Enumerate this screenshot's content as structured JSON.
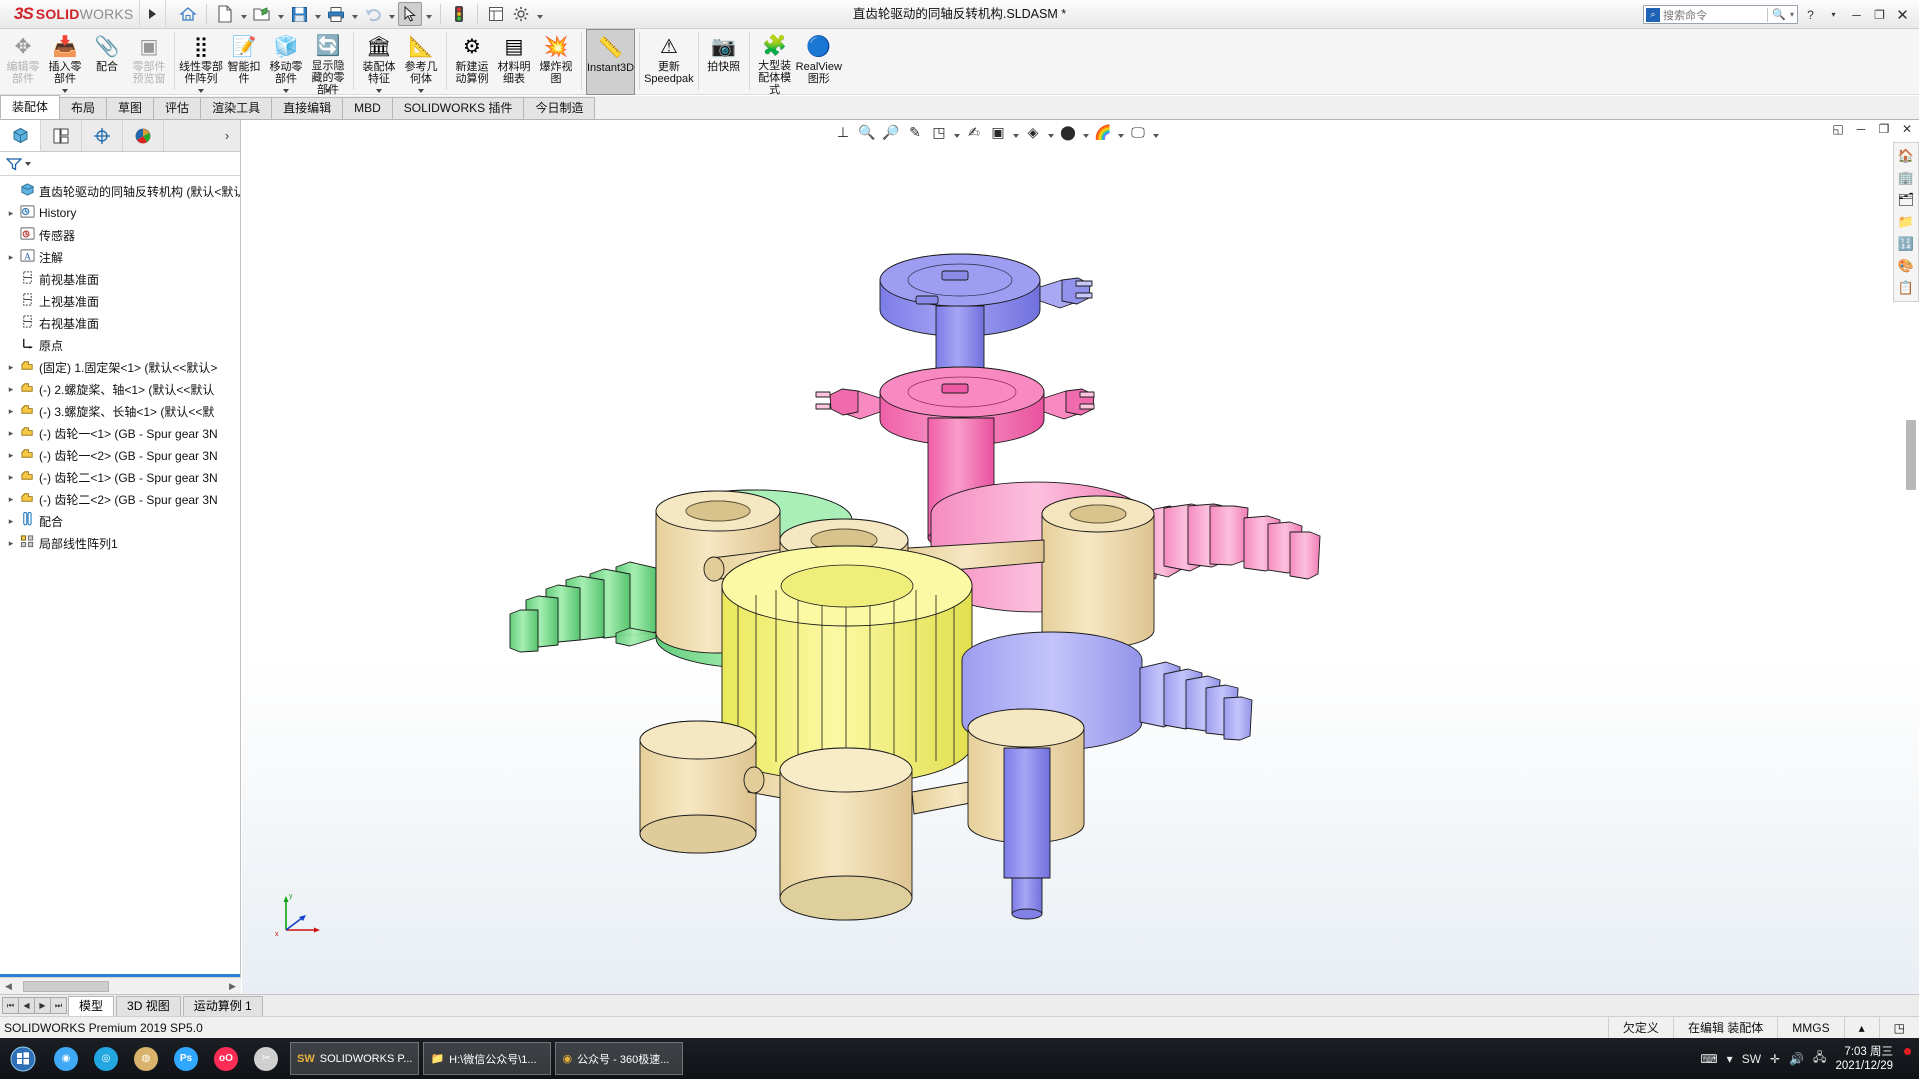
{
  "titlebar": {
    "logo_ds": "3S",
    "logo_solid": "SOLID",
    "logo_works": "WORKS",
    "document_title": "直齿轮驱动的同轴反转机构.SLDASM *",
    "quick_access": [
      {
        "name": "home-icon",
        "glyph": "⌂"
      },
      {
        "name": "new-document-icon",
        "glyph": "🗋"
      },
      {
        "name": "open-document-icon",
        "glyph": "📂"
      },
      {
        "name": "save-icon",
        "glyph": "💾"
      },
      {
        "name": "print-icon",
        "glyph": "🖶"
      },
      {
        "name": "undo-icon",
        "glyph": "↩"
      },
      {
        "name": "select-icon",
        "glyph": "➤"
      },
      {
        "name": "rebuild-icon",
        "glyph": "🚦"
      },
      {
        "name": "options-page-icon",
        "glyph": "▤"
      },
      {
        "name": "settings-gear-icon",
        "glyph": "⚙"
      }
    ],
    "search_placeholder": "搜索命令",
    "window_buttons": [
      "?",
      "▾",
      "─",
      "❐",
      "✕"
    ]
  },
  "ribbon": {
    "buttons": [
      {
        "label": "编辑零\n部件",
        "icon": "✥",
        "state": "disabled",
        "dropdown": false
      },
      {
        "label": "插入零\n部件",
        "icon": "📥",
        "state": "normal",
        "dropdown": true
      },
      {
        "label": "配合",
        "icon": "📎",
        "state": "normal",
        "dropdown": false
      },
      {
        "label": "零部件\n预览窗",
        "icon": "▣",
        "state": "disabled",
        "dropdown": false
      },
      {
        "label": "线性零部\n件阵列",
        "icon": "⣿",
        "state": "normal",
        "dropdown": true
      },
      {
        "label": "智能扣\n件",
        "icon": "📝",
        "state": "normal",
        "dropdown": false
      },
      {
        "label": "移动零\n部件",
        "icon": "🧊",
        "state": "normal",
        "dropdown": true
      },
      {
        "label": "显示隐\n藏的零\n部件",
        "icon": "🔄",
        "state": "normal",
        "dropdown": true
      },
      {
        "label": "装配体\n特征",
        "icon": "🏛",
        "state": "normal",
        "dropdown": true
      },
      {
        "label": "参考几\n何体",
        "icon": "📐",
        "state": "normal",
        "dropdown": true
      },
      {
        "label": "新建运\n动算例",
        "icon": "⚙",
        "state": "normal",
        "dropdown": false
      },
      {
        "label": "材料明\n细表",
        "icon": "▤",
        "state": "normal",
        "dropdown": false
      },
      {
        "label": "爆炸视\n图",
        "icon": "💥",
        "state": "normal",
        "dropdown": false
      },
      {
        "label": "Instant3D",
        "icon": "📏",
        "state": "active",
        "dropdown": false
      },
      {
        "label": "更新\nSpeedpak",
        "icon": "⚠",
        "state": "normal",
        "dropdown": false
      },
      {
        "label": "拍快照",
        "icon": "📷",
        "state": "normal",
        "dropdown": false
      },
      {
        "label": "大型装\n配体模\n式",
        "icon": "🧩",
        "state": "normal",
        "dropdown": false
      },
      {
        "label": "RealView\n图形",
        "icon": "🔵",
        "state": "normal",
        "dropdown": false
      }
    ]
  },
  "command_tabs": {
    "items": [
      "装配体",
      "布局",
      "草图",
      "评估",
      "渲染工具",
      "直接编辑",
      "MBD",
      "SOLIDWORKS 插件",
      "今日制造"
    ],
    "selected": "装配体"
  },
  "left_panel": {
    "tabs": [
      {
        "name": "feature-tree-tab",
        "icon": "📦"
      },
      {
        "name": "property-manager-tab",
        "icon": "▤"
      },
      {
        "name": "configuration-manager-tab",
        "icon": "✛"
      },
      {
        "name": "display-manager-tab",
        "icon": "🎨"
      }
    ],
    "selected_tab": 0,
    "more_glyph": "›",
    "filter_placeholder": "",
    "tree": [
      {
        "arrow": "",
        "icon": "📦",
        "label": "直齿轮驱动的同轴反转机构  (默认<默认"
      },
      {
        "arrow": "▸",
        "icon": "🕑",
        "label": "History"
      },
      {
        "arrow": "",
        "icon": "🕐",
        "label": "传感器"
      },
      {
        "arrow": "▸",
        "icon": "🅰",
        "label": "注解"
      },
      {
        "arrow": "",
        "icon": "▯",
        "label": "前视基准面"
      },
      {
        "arrow": "",
        "icon": "▯",
        "label": "上视基准面"
      },
      {
        "arrow": "",
        "icon": "▯",
        "label": "右视基准面"
      },
      {
        "arrow": "",
        "icon": "⌐",
        "label": "原点"
      },
      {
        "arrow": "▸",
        "icon": "🟡",
        "label": "(固定) 1.固定架<1>  (默认<<默认>"
      },
      {
        "arrow": "▸",
        "icon": "🟡",
        "label": "(-) 2.螺旋桨、轴<1>  (默认<<默认"
      },
      {
        "arrow": "▸",
        "icon": "🟡",
        "label": "(-) 3.螺旋桨、长轴<1>  (默认<<默"
      },
      {
        "arrow": "▸",
        "icon": "🟡",
        "label": "(-) 齿轮一<1>  (GB - Spur gear 3N"
      },
      {
        "arrow": "▸",
        "icon": "🟡",
        "label": "(-) 齿轮一<2>  (GB - Spur gear 3N"
      },
      {
        "arrow": "▸",
        "icon": "🟡",
        "label": "(-) 齿轮二<1>  (GB - Spur gear 3N"
      },
      {
        "arrow": "▸",
        "icon": "🟡",
        "label": "(-) 齿轮二<2>  (GB - Spur gear 3N"
      },
      {
        "arrow": "▸",
        "icon": "📎",
        "label": "配合"
      },
      {
        "arrow": "▸",
        "icon": "⣿",
        "label": "局部线性阵列1"
      }
    ]
  },
  "graphics_toolbar": {
    "buttons": [
      {
        "name": "section-view-icon",
        "glyph": "⊥"
      },
      {
        "name": "zoom-to-fit-icon",
        "glyph": "🔍"
      },
      {
        "name": "zoom-area-icon",
        "glyph": "🔎"
      },
      {
        "name": "previous-view-icon",
        "glyph": "✎"
      },
      {
        "name": "view-orientation-icon",
        "glyph": "◳"
      },
      {
        "name": "3d-drawing-view-icon",
        "glyph": "✍"
      },
      {
        "name": "display-style-icon",
        "glyph": "▣"
      },
      {
        "name": "hide-show-items-icon",
        "glyph": "◈"
      },
      {
        "name": "edit-appearance-icon",
        "glyph": "⬤"
      },
      {
        "name": "apply-scene-icon",
        "glyph": "🌈"
      },
      {
        "name": "view-settings-icon",
        "glyph": "🖵"
      }
    ],
    "window_controls": [
      "◱",
      "─",
      "❐",
      "✕"
    ]
  },
  "right_tools": [
    {
      "name": "view-palette-icon",
      "glyph": "🏠"
    },
    {
      "name": "appearances-icon",
      "glyph": "🏢"
    },
    {
      "name": "design-library-icon",
      "glyph": "🗂"
    },
    {
      "name": "file-explorer-icon",
      "glyph": "📁"
    },
    {
      "name": "search-library-icon",
      "glyph": "🔢"
    },
    {
      "name": "view-palette2-icon",
      "glyph": "🎨"
    },
    {
      "name": "custom-properties-icon",
      "glyph": "📋"
    }
  ],
  "doc_tabs": {
    "nav": [
      "⏮",
      "◀",
      "▶",
      "⏭"
    ],
    "items": [
      "模型",
      "3D 视图",
      "运动算例 1"
    ],
    "selected": "模型"
  },
  "status_bar": {
    "left": "SOLIDWORKS Premium 2019 SP5.0",
    "items": [
      "欠定义",
      "在编辑 装配体",
      "MMGS",
      "▴"
    ]
  },
  "taskbar": {
    "start_glyph": "⊞",
    "pinned": [
      {
        "name": "taskbar-icon-app1",
        "glyph": "◉",
        "color": "#3fa9f5"
      },
      {
        "name": "taskbar-icon-app2",
        "glyph": "◎",
        "color": "#22a7e0"
      },
      {
        "name": "taskbar-icon-app3",
        "glyph": "◍",
        "color": "#d9b36c"
      },
      {
        "name": "taskbar-icon-photoshop",
        "glyph": "Ps",
        "color": "#31a8ff"
      },
      {
        "name": "taskbar-icon-app5",
        "glyph": "oO",
        "color": "#ff2d55"
      },
      {
        "name": "taskbar-icon-snip",
        "glyph": "✂",
        "color": "#d0d0d0"
      }
    ],
    "tasks": [
      {
        "name": "taskbar-task-solidworks",
        "icon": "SW",
        "label": "SOLIDWORKS P..."
      },
      {
        "name": "taskbar-task-explorer",
        "icon": "📁",
        "label": "H:\\微信公众号\\1..."
      },
      {
        "name": "taskbar-task-browser",
        "icon": "◉",
        "label": "公众号 - 360极速..."
      }
    ],
    "tray": [
      {
        "name": "tray-keyboard-icon",
        "glyph": "⌨"
      },
      {
        "name": "tray-expand-icon",
        "glyph": "▾"
      },
      {
        "name": "tray-solidworks-icon",
        "glyph": "SW"
      },
      {
        "name": "tray-shield-icon",
        "glyph": "✛"
      },
      {
        "name": "tray-volume-icon",
        "glyph": "🔊"
      },
      {
        "name": "tray-network-icon",
        "glyph": "🖧"
      }
    ],
    "clock_time": "7:03 周三",
    "clock_date": "2021/12/29"
  },
  "model": {
    "description": "Coaxial counter-rotating spur gear mechanism assembly",
    "colors": {
      "blue_shaft": "#8c8cf0",
      "pink_hub": "#f573b6",
      "tan_frame": "#f0dcae",
      "green_gear": "#7bdd8e",
      "yellow_gear": "#f6f06a",
      "pink_gear": "#f79ec8",
      "purple_gear": "#a9a9f5"
    }
  }
}
